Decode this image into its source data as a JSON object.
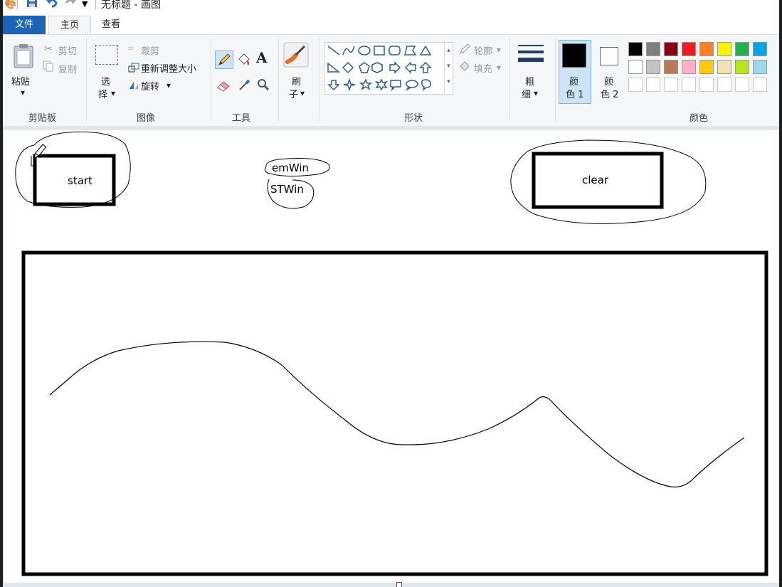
{
  "window": {
    "title": "无标题 - 画图"
  },
  "tabs": {
    "file": "文件",
    "home": "主页",
    "view": "查看"
  },
  "clipboard": {
    "paste": "粘贴",
    "cut": "剪切",
    "copy": "复制",
    "group": "剪贴板"
  },
  "image": {
    "select_line1": "选",
    "select_line2": "择",
    "crop": "裁剪",
    "resize": "重新调整大小",
    "rotate": "旋转",
    "group": "图像"
  },
  "tools": {
    "group": "工具",
    "text_glyph": "A"
  },
  "brushes": {
    "line1": "刷",
    "line2": "子"
  },
  "shapes": {
    "outline": "轮廓",
    "fill": "填充",
    "group": "形状"
  },
  "size": {
    "line1": "粗",
    "line2": "细"
  },
  "color1": {
    "line1": "颜",
    "line2": "色 1",
    "value": "#000000"
  },
  "color2": {
    "line1": "颜",
    "line2": "色 2",
    "value": "#ffffff"
  },
  "colors": {
    "group": "颜色",
    "row1": [
      "#000000",
      "#7f7f7f",
      "#880015",
      "#ed1c24",
      "#ff7f27",
      "#fff200",
      "#22b14c",
      "#00a2e8"
    ],
    "row2": [
      "#ffffff",
      "#c3c3c3",
      "#b97a57",
      "#ffaec9",
      "#ffc90e",
      "#efe4b0",
      "#b5e61d",
      "#99d9ea"
    ],
    "row3": [
      "#ffffff",
      "#ffffff",
      "#ffffff",
      "#ffffff",
      "#ffffff",
      "#ffffff",
      "#ffffff",
      "#ffffff"
    ]
  },
  "drawing": {
    "start_label": "start",
    "clear_label": "clear",
    "emwin_label": "emWin",
    "stwin_label": "STWin"
  }
}
